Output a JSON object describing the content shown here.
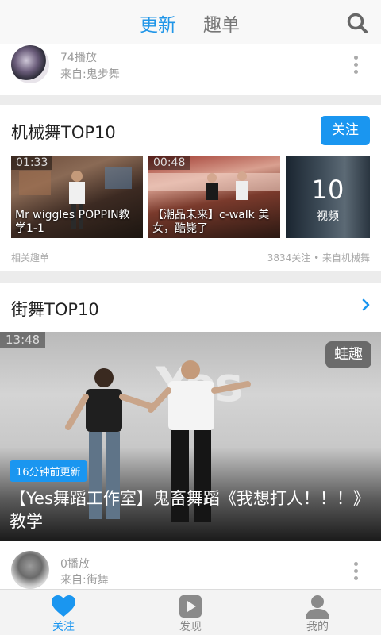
{
  "header": {
    "tab_active": "更新",
    "tab_other": "趣单",
    "search_icon": "search-icon"
  },
  "feed_top": {
    "plays": "74播放",
    "source": "来自:鬼步舞"
  },
  "section1": {
    "title": "机械舞TOP10",
    "follow_label": "关注",
    "videos": [
      {
        "duration": "01:33",
        "title": "Mr wiggles POPPIN教学1-1"
      },
      {
        "duration": "00:48",
        "title": "【潮品未来】c-walk 美女，酷毙了"
      }
    ],
    "count_number": "10",
    "count_label": "视频",
    "footer_left": "相关趣单",
    "footer_right": "3834关注 • 来自机械舞"
  },
  "section2": {
    "title": "街舞TOP10",
    "video": {
      "duration": "13:48",
      "watermark": "蛙趣",
      "bg_text": "Yes",
      "updated": "16分钟前更新",
      "title": "【Yes舞蹈工作室】鬼畜舞蹈《我想打人！！！》教学"
    },
    "plays": "0播放",
    "source": "来自:街舞"
  },
  "nav": [
    {
      "label": "关注",
      "icon": "heart-icon",
      "active": true
    },
    {
      "label": "发现",
      "icon": "play-icon",
      "active": false
    },
    {
      "label": "我的",
      "icon": "user-icon",
      "active": false
    }
  ],
  "colors": {
    "accent": "#1a96f0",
    "muted": "#9b9b9b"
  }
}
